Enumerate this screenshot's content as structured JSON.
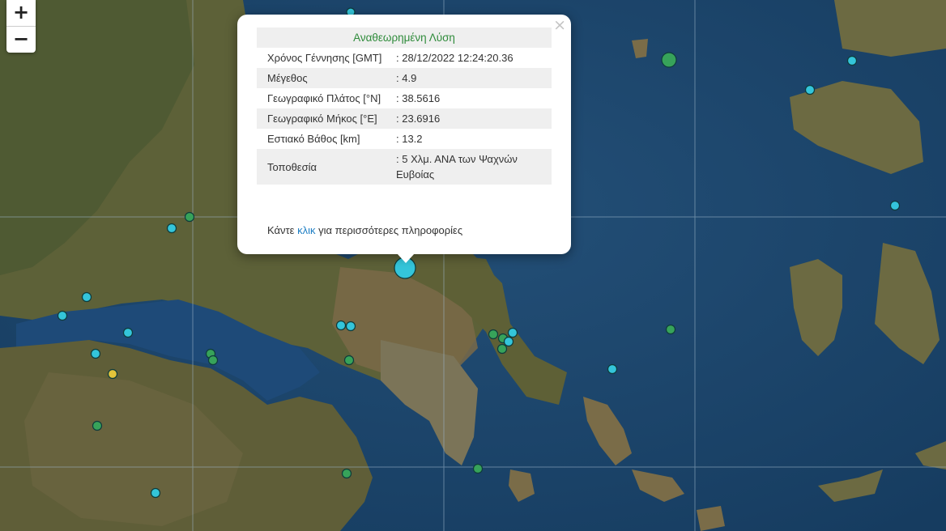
{
  "map": {
    "zoom_in": "+",
    "zoom_out": "−",
    "marker_colors": {
      "blue": "#34c5da",
      "green": "#37a35a",
      "yellow": "#e3c43a"
    }
  },
  "popup": {
    "close": "×",
    "title": "Αναθεωρημένη Λύση",
    "rows": [
      {
        "label": "Χρόνος Γέννησης [GMT]",
        "value": ": 28/12/2022 12:24:20.36"
      },
      {
        "label": "Μέγεθος",
        "value": ": 4.9"
      },
      {
        "label": "Γεωγραφικό Πλάτος [°N]",
        "value": ": 38.5616"
      },
      {
        "label": "Γεωγραφικό Μήκος [°E]",
        "value": ": 23.6916"
      },
      {
        "label": "Εστιακό Βάθος [km]",
        "value": ": 13.2"
      },
      {
        "label": "Τοποθεσία",
        "value": ": 5 Χλμ. ΑΝΑ των Ψαχνών Ευβοίας"
      }
    ],
    "more_prefix": "Κάντε",
    "more_link": "κλικ",
    "more_suffix": "για περισσότερες πληροφορίες"
  }
}
